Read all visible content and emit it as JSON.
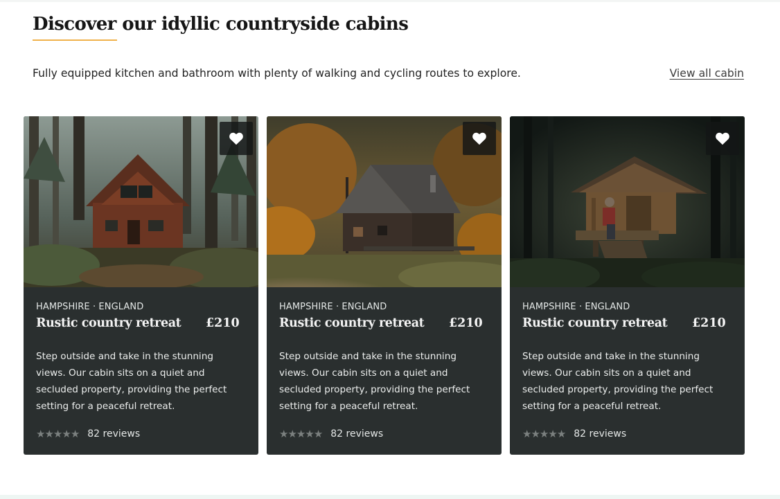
{
  "section": {
    "title": "Discover our idyllic countryside cabins",
    "intro": "Fully equipped kitchen and bathroom with plenty of walking and cycling routes to explore.",
    "view_all_label": "View all cabin",
    "accent_color": "#f0b24b"
  },
  "cards": [
    {
      "location": "HAMPSHIRE · ENGLAND",
      "title": "Rustic country retreat",
      "price": "£210",
      "description": "Step outside and take in the stunning views. Our cabin sits on a quiet and secluded property, providing the perfect setting for a peaceful retreat.",
      "rating_stars": 5,
      "reviews": "82 reviews",
      "favorite_icon": "heart-icon"
    },
    {
      "location": "HAMPSHIRE · ENGLAND",
      "title": "Rustic country retreat",
      "price": "£210",
      "description": "Step outside and take in the stunning views. Our cabin sits on a quiet and secluded property, providing the perfect setting for a peaceful retreat.",
      "rating_stars": 5,
      "reviews": "82 reviews",
      "favorite_icon": "heart-icon"
    },
    {
      "location": "HAMPSHIRE · ENGLAND",
      "title": "Rustic country retreat",
      "price": "£210",
      "description": "Step outside and take in the stunning views. Our cabin sits on a quiet and secluded property, providing the perfect setting for a peaceful retreat.",
      "rating_stars": 5,
      "reviews": "82 reviews",
      "favorite_icon": "heart-icon"
    }
  ],
  "colors": {
    "card_background": "#2a2f2f",
    "star_color": "#7b807f"
  }
}
